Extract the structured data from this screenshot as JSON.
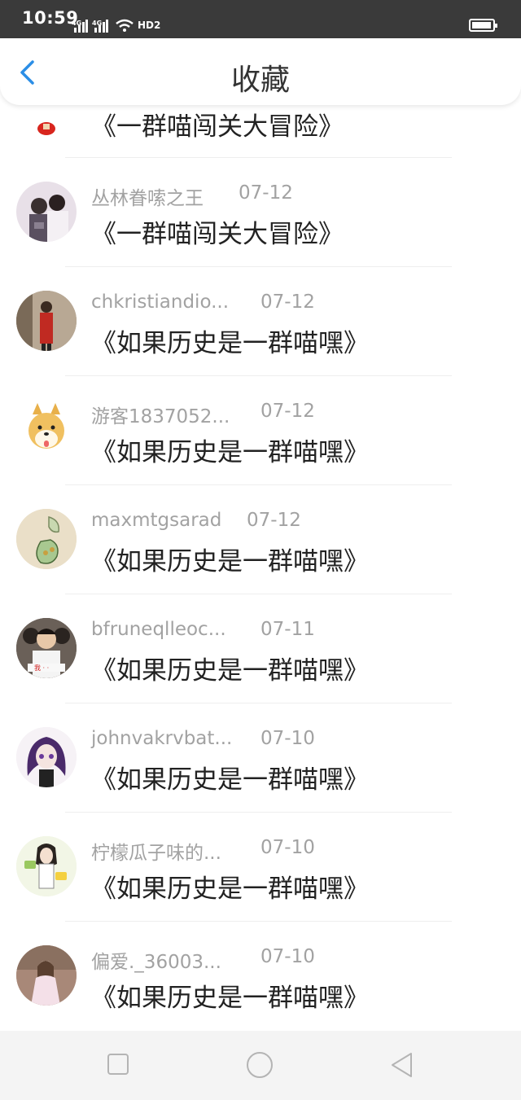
{
  "status_bar": {
    "time": "10:59",
    "signal_1": "4G",
    "signal_2": "4G",
    "hd_label": "HD2",
    "icons": [
      "signal-icon",
      "signal-icon",
      "wifi-icon",
      "battery-icon"
    ]
  },
  "header": {
    "title": "收藏",
    "back_icon": "chevron-left-icon",
    "accent_color": "#2b8ee6"
  },
  "favorites": [
    {
      "username": "",
      "date": "",
      "comic": "《一群喵闯关大冒险》"
    },
    {
      "username": "丛林眷嗦之王",
      "date": "07-12",
      "comic": "《一群喵闯关大冒险》"
    },
    {
      "username": "chkristiandio...",
      "date": "07-12",
      "comic": "《如果历史是一群喵嘿》"
    },
    {
      "username": "游客1837052...",
      "date": "07-12",
      "comic": "《如果历史是一群喵嘿》"
    },
    {
      "username": "maxmtgsarad",
      "date": "07-12",
      "comic": "《如果历史是一群喵嘿》"
    },
    {
      "username": "bfruneqlleoc...",
      "date": "07-11",
      "comic": "《如果历史是一群喵嘿》"
    },
    {
      "username": "johnvakrvbat...",
      "date": "07-10",
      "comic": "《如果历史是一群喵嘿》"
    },
    {
      "username": "柠檬瓜子味的...",
      "date": "07-10",
      "comic": "《如果历史是一群喵嘿》"
    },
    {
      "username": "偏爱._36003...",
      "date": "07-10",
      "comic": "《如果历史是一群喵嘿》"
    }
  ],
  "nav_bar": {
    "buttons": [
      "recent-apps-icon",
      "home-icon",
      "back-triangle-icon"
    ]
  }
}
